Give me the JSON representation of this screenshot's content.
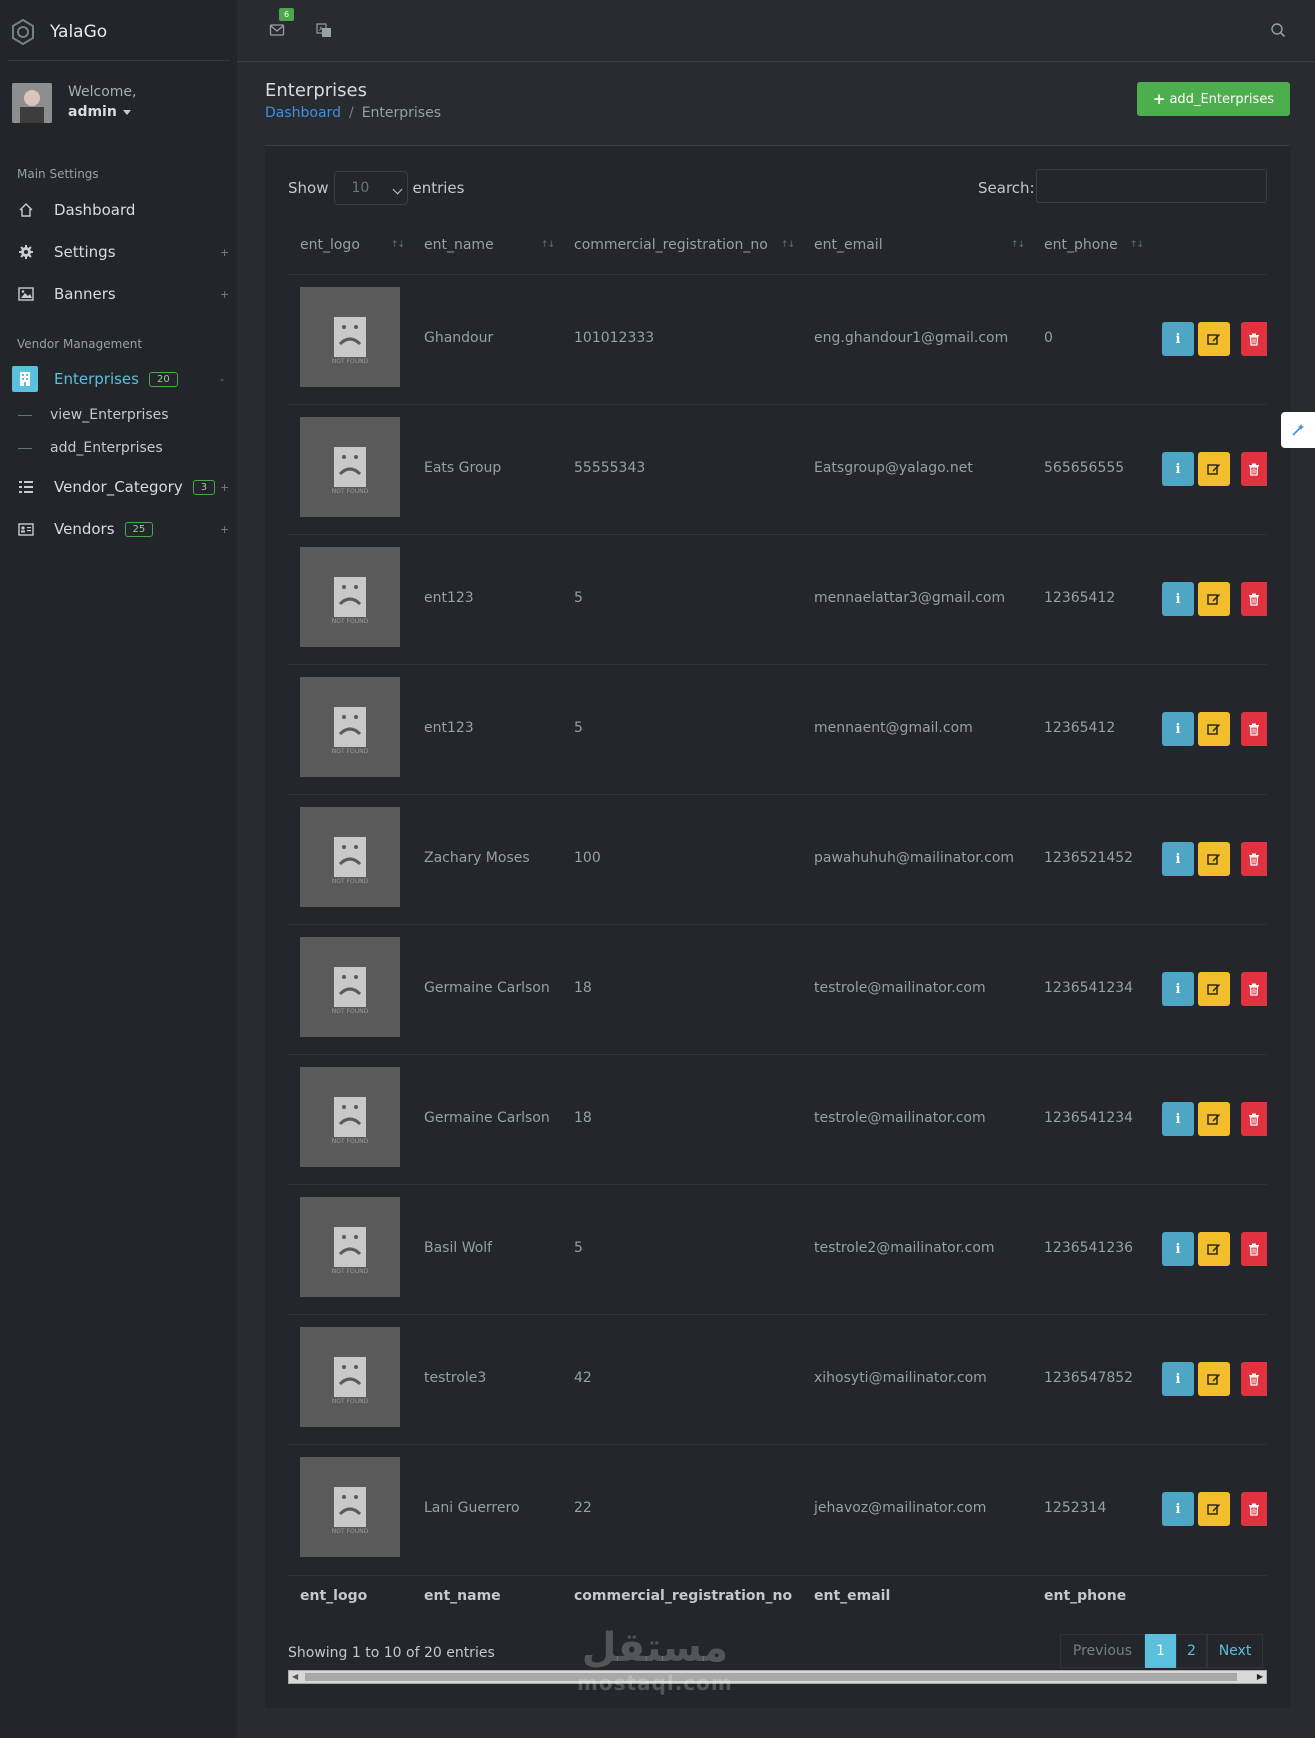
{
  "app": {
    "name": "YalaGo"
  },
  "profile": {
    "welcome": "Welcome,",
    "username": "admin"
  },
  "sidebar": {
    "sections": [
      {
        "title": "Main Settings"
      },
      {
        "title": "Vendor Management"
      }
    ],
    "items": [
      {
        "label": "Dashboard",
        "icon": "home-icon"
      },
      {
        "label": "Settings",
        "icon": "gear-icon",
        "toggle": "+"
      },
      {
        "label": "Banners",
        "icon": "image-icon",
        "toggle": "+"
      },
      {
        "label": "Enterprises",
        "icon": "building-icon",
        "badge": "20",
        "toggle": "-"
      },
      {
        "label": "Vendor_Category",
        "icon": "list-icon",
        "badge": "3",
        "toggle": "+"
      },
      {
        "label": "Vendors",
        "icon": "id-card-icon",
        "badge": "25",
        "toggle": "+"
      }
    ],
    "subitems": [
      {
        "label": "view_Enterprises"
      },
      {
        "label": "add_Enterprises"
      }
    ]
  },
  "topbar": {
    "mail_badge": "6"
  },
  "page": {
    "title": "Enterprises",
    "breadcrumb_home": "Dashboard",
    "breadcrumb_sep": "/",
    "breadcrumb_current": "Enterprises",
    "add_button": "add_Enterprises"
  },
  "table": {
    "show_label": "Show",
    "entries_value": "10",
    "entries_label": "entries",
    "search_label": "Search:",
    "columns": [
      "ent_logo",
      "ent_name",
      "commercial_registration_no",
      "ent_email",
      "ent_phone"
    ],
    "rows": [
      {
        "name": "Ghandour",
        "reg": "101012333",
        "email": "eng.ghandour1@gmail.com",
        "phone": "0"
      },
      {
        "name": "Eats Group",
        "reg": "55555343",
        "email": "Eatsgroup@yalago.net",
        "phone": "565656555"
      },
      {
        "name": "ent123",
        "reg": "5",
        "email": "mennaelattar3@gmail.com",
        "phone": "12365412"
      },
      {
        "name": "ent123",
        "reg": "5",
        "email": "mennaent@gmail.com",
        "phone": "12365412"
      },
      {
        "name": "Zachary Moses",
        "reg": "100",
        "email": "pawahuhuh@mailinator.com",
        "phone": "1236521452"
      },
      {
        "name": "Germaine Carlson",
        "reg": "18",
        "email": "testrole@mailinator.com",
        "phone": "1236541234"
      },
      {
        "name": "Germaine Carlson",
        "reg": "18",
        "email": "testrole@mailinator.com",
        "phone": "1236541234"
      },
      {
        "name": "Basil Wolf",
        "reg": "5",
        "email": "testrole2@mailinator.com",
        "phone": "1236541236"
      },
      {
        "name": "testrole3",
        "reg": "42",
        "email": "xihosyti@mailinator.com",
        "phone": "1236547852"
      },
      {
        "name": "Lani Guerrero",
        "reg": "22",
        "email": "jehavoz@mailinator.com",
        "phone": "1252314"
      }
    ],
    "logo_placeholder_text": "NOT FOUND",
    "info": "Showing 1 to 10 of 20 entries",
    "pagination": {
      "previous": "Previous",
      "pages": [
        "1",
        "2"
      ],
      "next": "Next"
    }
  },
  "watermark": {
    "arabic": "مستقل",
    "latin": "mostaql.com"
  },
  "colors": {
    "success": "#4cae4c",
    "info": "#4fa5c4",
    "warning": "#f3be2c",
    "danger": "#e0333f",
    "accent": "#5bc0de",
    "link": "#3f8fe0"
  }
}
